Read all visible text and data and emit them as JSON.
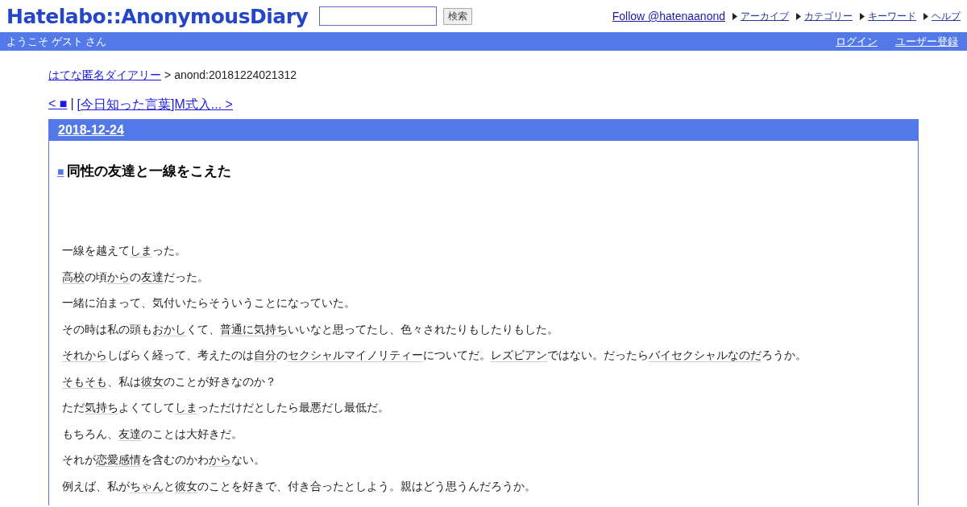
{
  "header": {
    "logo": "Hatelabo::AnonymousDiary",
    "search_button": "検索",
    "follow": "Follow @hatenaanond",
    "nav": [
      "アーカイブ",
      "カテゴリー",
      "キーワード",
      "ヘルプ"
    ]
  },
  "welcome_bar": {
    "greeting": "ようこそ ゲスト さん",
    "links": [
      "ログイン",
      "ユーザー登録"
    ]
  },
  "breadcrumb": {
    "home": "はてな匿名ダイアリー",
    "separator": ">",
    "current": "anond:20181224021312"
  },
  "pager": {
    "prev": "< ■",
    "separator": "|",
    "next": "[今日知った言葉]M式入... >"
  },
  "entry": {
    "date": "2018-12-24",
    "mark": "■",
    "title": "同性の友達と一線をこえた",
    "paragraphs": [
      [
        {
          "text": "一線を越えて"
        },
        {
          "text": "しま",
          "keyword": true
        },
        {
          "text": "った。"
        }
      ],
      [
        {
          "text": "高校",
          "keyword": true
        },
        {
          "text": "の頃"
        },
        {
          "text": "から",
          "keyword": true
        },
        {
          "text": "の"
        },
        {
          "text": "友達",
          "keyword": true
        },
        {
          "text": "だった。"
        }
      ],
      [
        {
          "text": "一緒に泊まって、気付いたらそういうことになっていた。"
        }
      ],
      [
        {
          "text": "その時は私の頭も"
        },
        {
          "text": "おかし",
          "keyword": true
        },
        {
          "text": "くて、"
        },
        {
          "text": "普通に気持ち",
          "keyword": true
        },
        {
          "text": "いいなと思ってたし、色々されたりもしたりもした。"
        }
      ],
      [
        {
          "text": "それから",
          "keyword": true
        },
        {
          "text": "しばらく経って、考えたのは"
        },
        {
          "text": "自分",
          "keyword": true
        },
        {
          "text": "の"
        },
        {
          "text": "セクシャルマイノリティー",
          "keyword": true
        },
        {
          "text": "についてだ。"
        },
        {
          "text": "レズビアン",
          "keyword": true
        },
        {
          "text": "ではない。だったら"
        },
        {
          "text": "バイセクシャルなのだ",
          "keyword": true
        },
        {
          "text": "ろうか。"
        }
      ],
      [
        {
          "text": "そもそも",
          "keyword": true
        },
        {
          "text": "、私は"
        },
        {
          "text": "彼女",
          "keyword": true
        },
        {
          "text": "のことが好きなのか？"
        }
      ],
      [
        {
          "text": "ただ"
        },
        {
          "text": "気持ち",
          "keyword": true
        },
        {
          "text": "よくてして"
        },
        {
          "text": "しま",
          "keyword": true
        },
        {
          "text": "っただけだとしたら最悪だし最低だ。"
        }
      ],
      [
        {
          "text": "もちろん、"
        },
        {
          "text": "友達",
          "keyword": true
        },
        {
          "text": "のことは大好きだ。"
        }
      ],
      [
        {
          "text": "それが"
        },
        {
          "text": "恋愛感情",
          "keyword": true
        },
        {
          "text": "を含むのかわ"
        },
        {
          "text": "から",
          "keyword": true
        },
        {
          "text": "ない。"
        }
      ],
      [
        {
          "text": "例えば、私が"
        },
        {
          "text": "ちゃん",
          "keyword": true
        },
        {
          "text": "と"
        },
        {
          "text": "彼女",
          "keyword": true
        },
        {
          "text": "のことを好きで、付き合ったとしよう。親はどう思うんだろうか。"
        }
      ]
    ]
  }
}
